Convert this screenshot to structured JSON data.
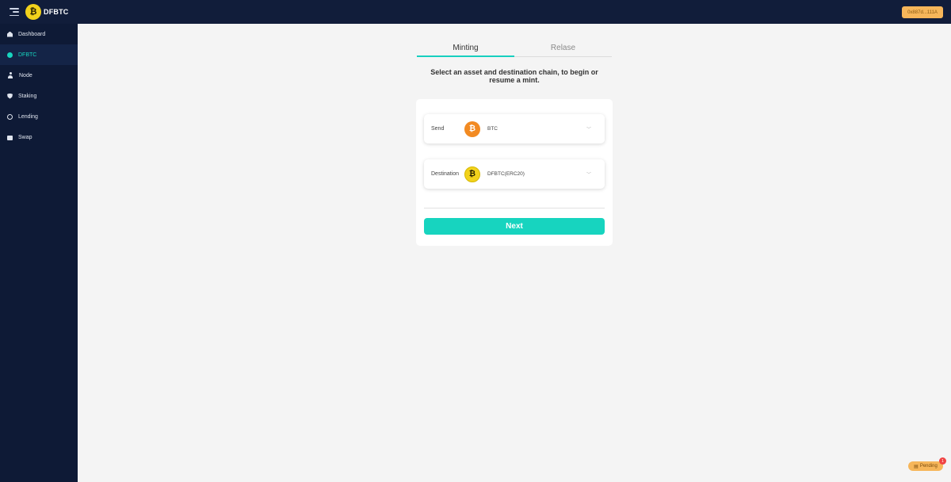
{
  "header": {
    "app_name": "DFBTC",
    "logo_glyph": "₿",
    "wallet_address": "0x887d...111A"
  },
  "sidebar": {
    "items": [
      {
        "label": "Dashboard",
        "icon": "dashboard-icon",
        "active": false
      },
      {
        "label": "DFBTC",
        "icon": "dfbtc-icon",
        "active": true
      },
      {
        "label": "Node",
        "icon": "node-icon",
        "active": false
      },
      {
        "label": "Staking",
        "icon": "staking-icon",
        "active": false
      },
      {
        "label": "Lending",
        "icon": "lending-icon",
        "active": false
      },
      {
        "label": "Swap",
        "icon": "swap-icon",
        "active": false
      }
    ]
  },
  "main": {
    "tabs": [
      {
        "label": "Minting",
        "active": true
      },
      {
        "label": "Relase",
        "active": false
      }
    ],
    "subtitle_line1": "Select an asset and destination chain, to begin or",
    "subtitle_line2": "resume a mint.",
    "send": {
      "label": "Send",
      "value": "BTC",
      "coin_glyph": "₿"
    },
    "destination": {
      "label": "Destination",
      "value": "DFBTC(ERC20)",
      "coin_glyph": "₿"
    },
    "next_label": "Next"
  },
  "pending": {
    "label": "Pending",
    "count": "1"
  },
  "colors": {
    "accent": "#17d4bf",
    "sidebar_bg": "#0e1a36",
    "topbar_bg": "#111d3a",
    "wallet": "#f6b65a",
    "btc": "#f28a22",
    "dfbtc": "#f2d21c"
  }
}
